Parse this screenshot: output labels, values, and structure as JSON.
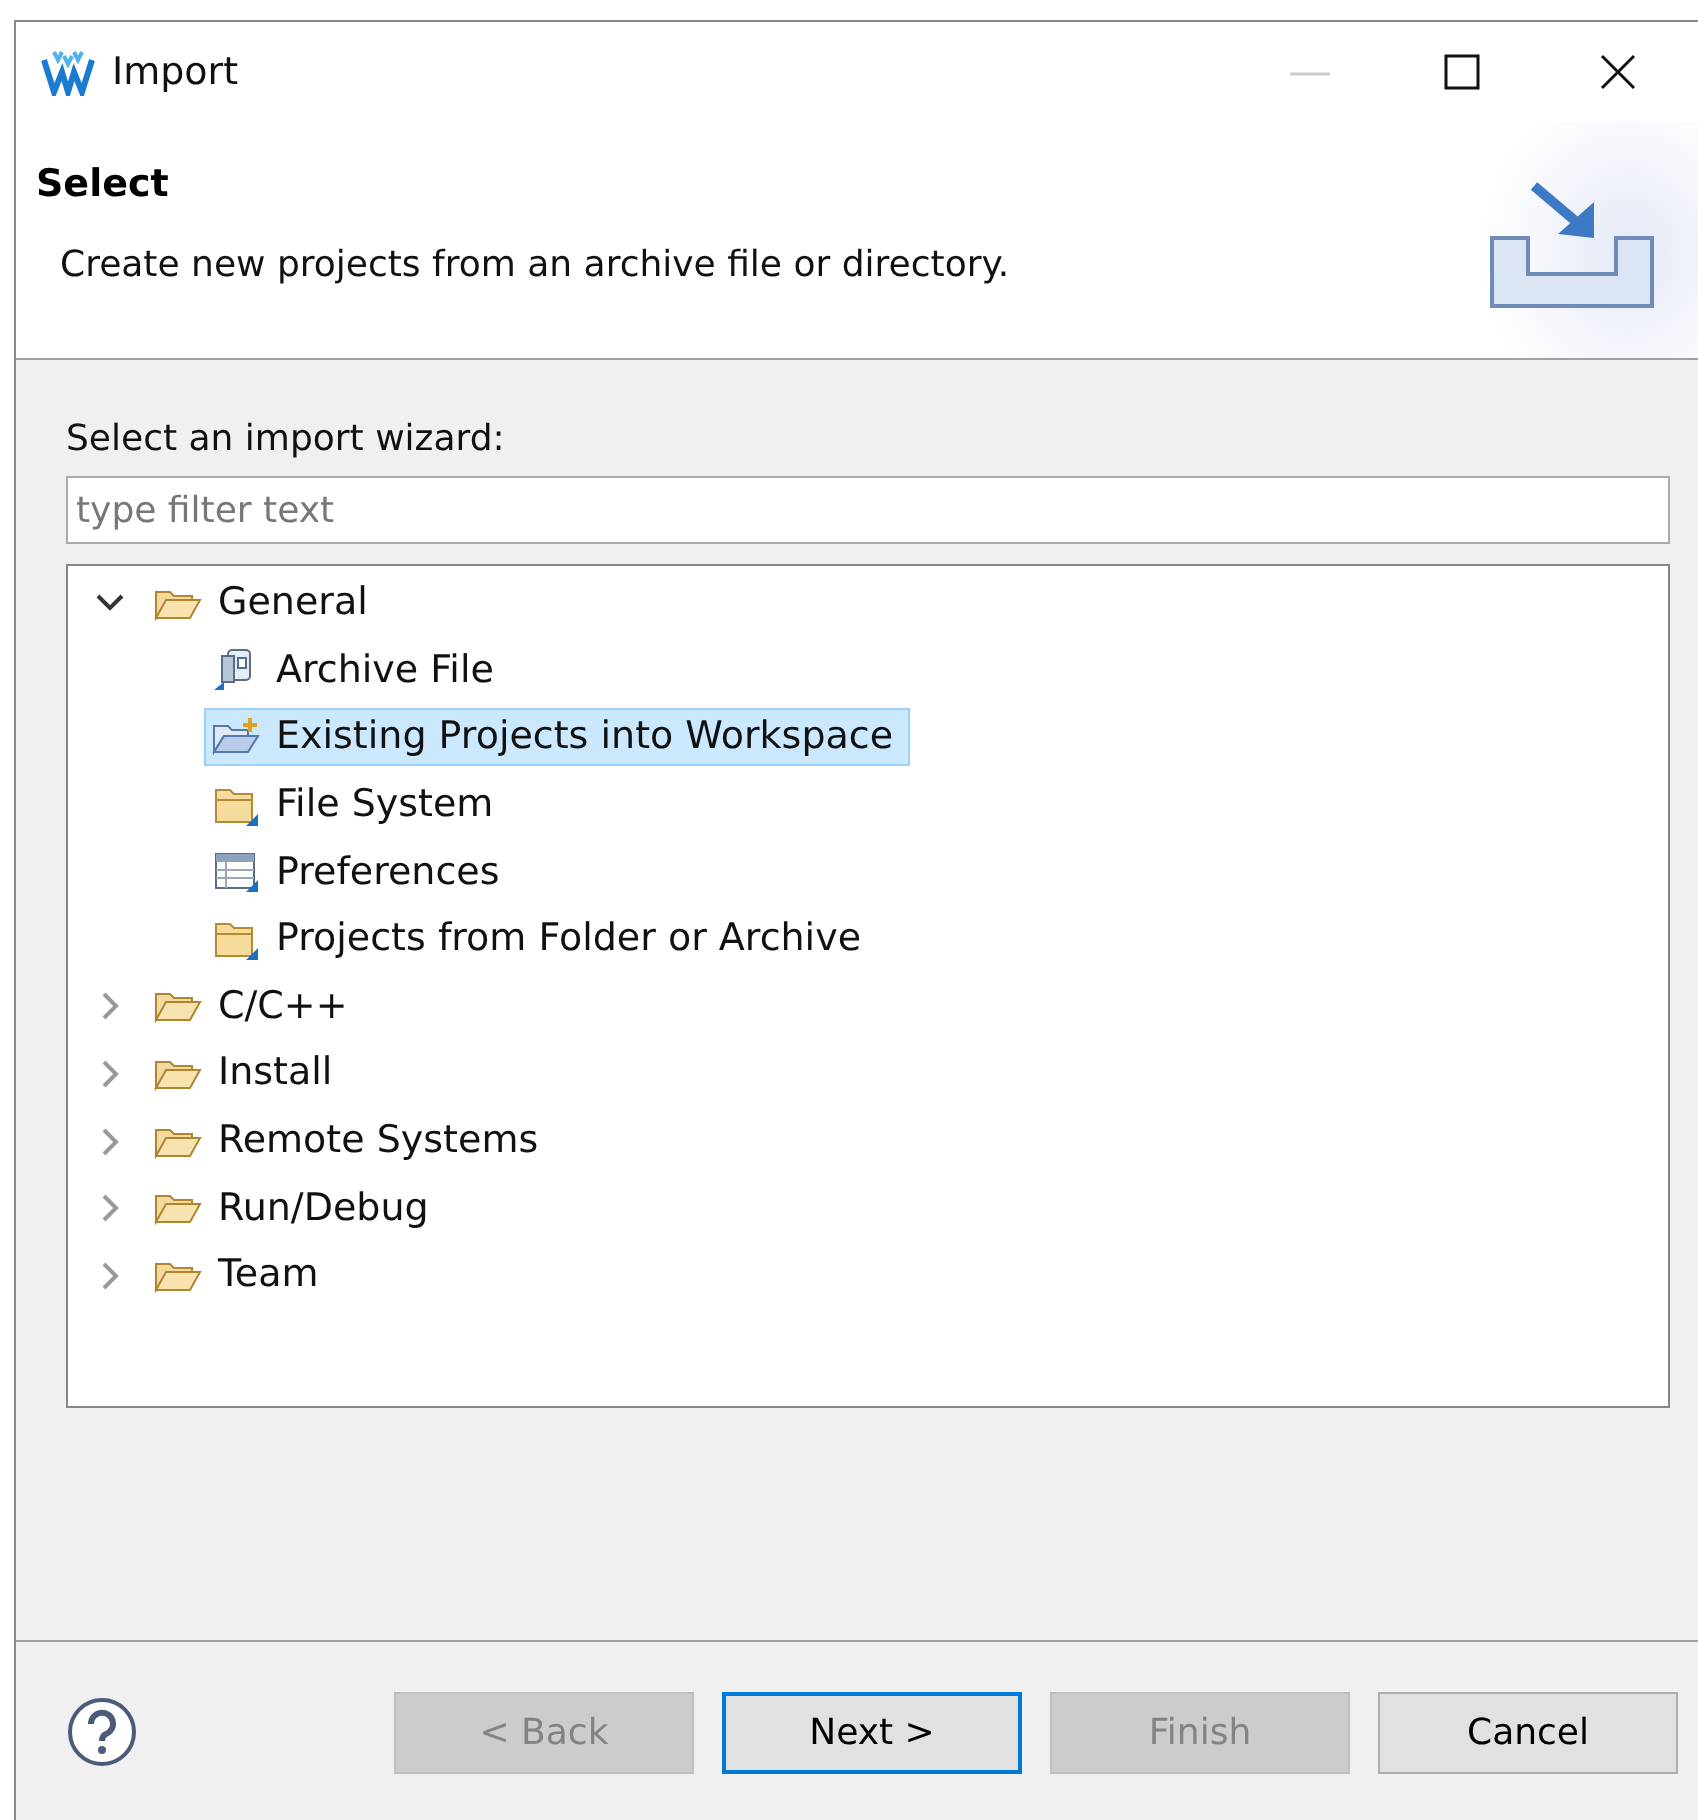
{
  "window": {
    "title": "Import"
  },
  "header": {
    "title": "Select",
    "description": "Create new projects from an archive file or directory."
  },
  "wizard_label": "Select an import wizard:",
  "filter": {
    "placeholder": "type filter text"
  },
  "tree": [
    {
      "label": "General",
      "kind": "category",
      "expanded": true,
      "selected": false,
      "children": [
        {
          "label": "Archive File",
          "kind": "archive",
          "selected": false
        },
        {
          "label": "Existing Projects into Workspace",
          "kind": "project",
          "selected": true
        },
        {
          "label": "File System",
          "kind": "folder",
          "selected": false
        },
        {
          "label": "Preferences",
          "kind": "preferences",
          "selected": false
        },
        {
          "label": "Projects from Folder or Archive",
          "kind": "folder",
          "selected": false
        }
      ]
    },
    {
      "label": "C/C++",
      "kind": "category",
      "expanded": false,
      "selected": false
    },
    {
      "label": "Install",
      "kind": "category",
      "expanded": false,
      "selected": false
    },
    {
      "label": "Remote Systems",
      "kind": "category",
      "expanded": false,
      "selected": false
    },
    {
      "label": "Run/Debug",
      "kind": "category",
      "expanded": false,
      "selected": false
    },
    {
      "label": "Team",
      "kind": "category",
      "expanded": false,
      "selected": false
    }
  ],
  "buttons": [
    {
      "label": "< Back",
      "disabled": true,
      "default": false
    },
    {
      "label": "Next >",
      "disabled": false,
      "default": true
    },
    {
      "label": "Finish",
      "disabled": true,
      "default": false
    },
    {
      "label": "Cancel",
      "disabled": false,
      "default": false
    }
  ]
}
